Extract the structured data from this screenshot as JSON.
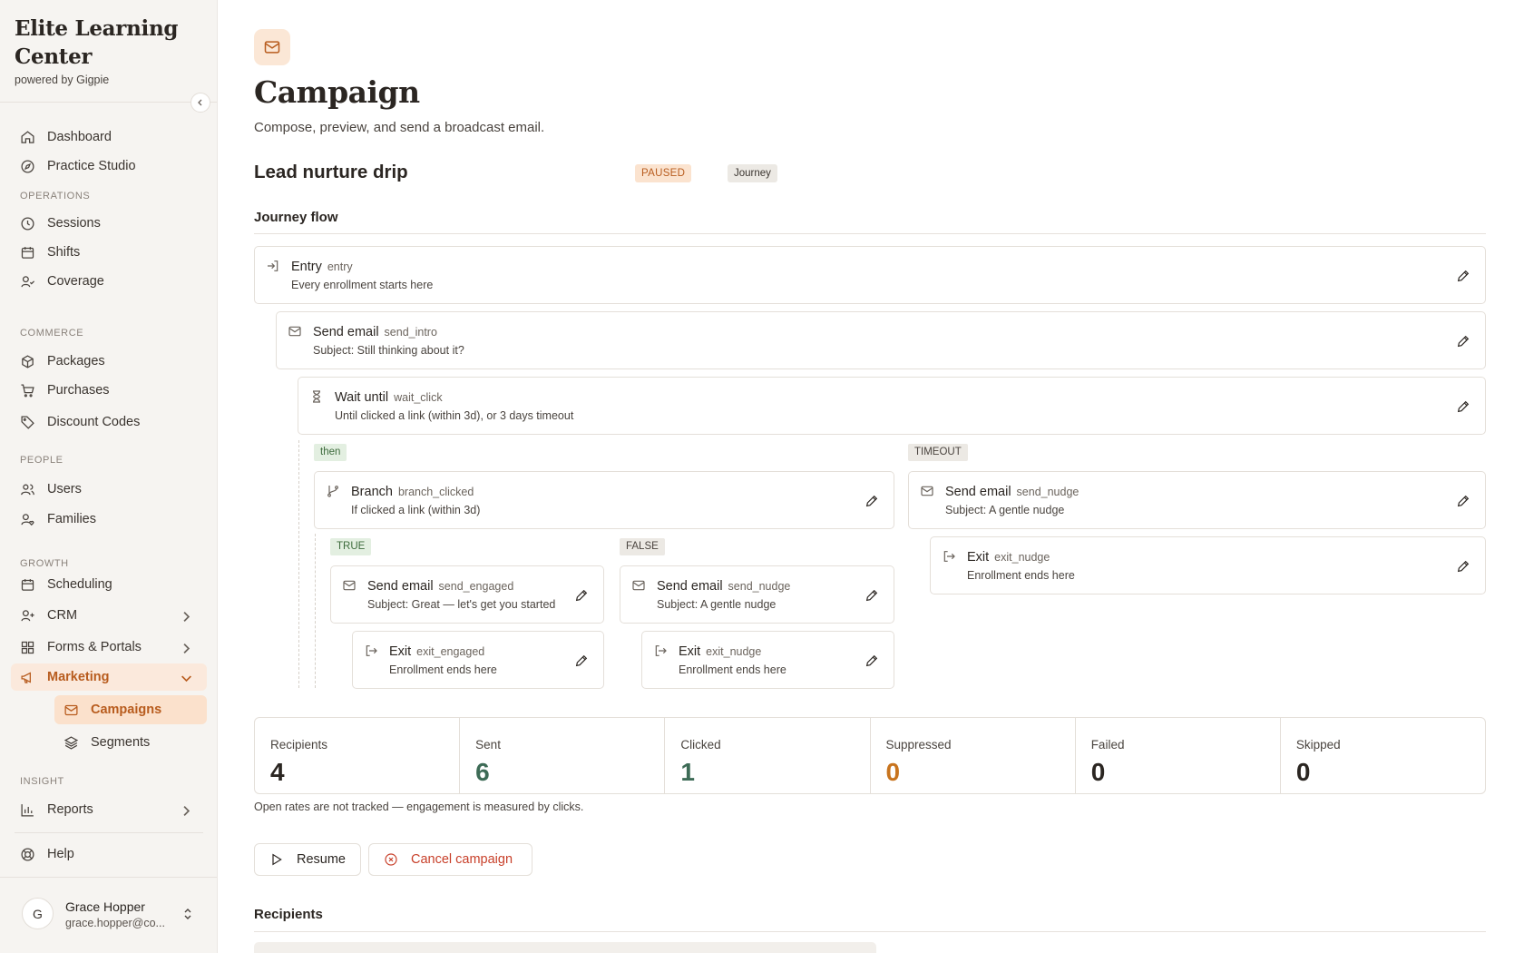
{
  "brand": {
    "name": "Elite Learning Center",
    "sub": "powered by Gigpie"
  },
  "nav": {
    "dashboard": "Dashboard",
    "practice": "Practice Studio",
    "sec_operations": "OPERATIONS",
    "sessions": "Sessions",
    "shifts": "Shifts",
    "coverage": "Coverage",
    "sec_commerce": "COMMERCE",
    "packages": "Packages",
    "purchases": "Purchases",
    "discounts": "Discount Codes",
    "sec_people": "PEOPLE",
    "users": "Users",
    "families": "Families",
    "sec_growth": "GROWTH",
    "scheduling": "Scheduling",
    "crm": "CRM",
    "forms": "Forms & Portals",
    "marketing": "Marketing",
    "campaigns": "Campaigns",
    "segments": "Segments",
    "sec_insight": "INSIGHT",
    "reports": "Reports",
    "help": "Help"
  },
  "user": {
    "initial": "G",
    "name": "Grace Hopper",
    "email": "grace.hopper@co..."
  },
  "page": {
    "title": "Campaign",
    "subtitle": "Compose, preview, and send a broadcast email.",
    "campaign_name": "Lead nurture drip",
    "status": "PAUSED",
    "type": "Journey",
    "flow_heading": "Journey flow"
  },
  "flow": {
    "entry": {
      "title": "Entry",
      "key": "entry",
      "desc": "Every enrollment starts here"
    },
    "send_intro": {
      "title": "Send email",
      "key": "send_intro",
      "desc": "Subject: Still thinking about it?"
    },
    "wait_click": {
      "title": "Wait until",
      "key": "wait_click",
      "desc": "Until clicked a link (within 3d), or 3 days timeout"
    },
    "then_label": "then",
    "timeout_label": "TIMEOUT",
    "branch": {
      "title": "Branch",
      "key": "branch_clicked",
      "desc": "If clicked a link (within 3d)"
    },
    "true_label": "TRUE",
    "false_label": "FALSE",
    "send_engaged": {
      "title": "Send email",
      "key": "send_engaged",
      "desc": "Subject: Great — let's get you started"
    },
    "exit_engaged": {
      "title": "Exit",
      "key": "exit_engaged",
      "desc": "Enrollment ends here"
    },
    "send_nudge_false": {
      "title": "Send email",
      "key": "send_nudge",
      "desc": "Subject: A gentle nudge"
    },
    "exit_nudge_false": {
      "title": "Exit",
      "key": "exit_nudge",
      "desc": "Enrollment ends here"
    },
    "send_nudge_timeout": {
      "title": "Send email",
      "key": "send_nudge",
      "desc": "Subject: A gentle nudge"
    },
    "exit_nudge_timeout": {
      "title": "Exit",
      "key": "exit_nudge",
      "desc": "Enrollment ends here"
    }
  },
  "stats": {
    "recipients": {
      "label": "Recipients",
      "value": "4"
    },
    "sent": {
      "label": "Sent",
      "value": "6"
    },
    "clicked": {
      "label": "Clicked",
      "value": "1"
    },
    "suppressed": {
      "label": "Suppressed",
      "value": "0"
    },
    "failed": {
      "label": "Failed",
      "value": "0"
    },
    "skipped": {
      "label": "Skipped",
      "value": "0"
    }
  },
  "colors": {
    "accent": "#b85c1e",
    "success": "#3d6b56",
    "warning": "#c8741e",
    "danger": "#c8402a"
  },
  "note": "Open rates are not tracked — engagement is measured by clicks.",
  "actions": {
    "resume": "Resume",
    "cancel": "Cancel campaign"
  },
  "recipients_heading": "Recipients",
  "icons": {
    "brand_collapse": "chevron-left-icon",
    "entry": "login-icon",
    "email": "mail-icon",
    "wait": "hourglass-icon",
    "branch": "git-branch-icon",
    "exit": "logout-icon",
    "edit": "pencil-icon"
  }
}
